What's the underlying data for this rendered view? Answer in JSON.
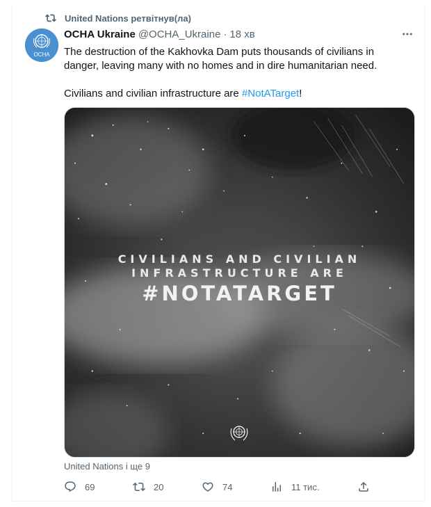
{
  "retweet": {
    "label": "United Nations ретвітнув(ла)",
    "icon": "retweet-icon"
  },
  "tweet": {
    "author_name": "OCHA Ukraine",
    "author_handle": "@OCHA_Ukraine",
    "separator": "·",
    "time": "18 хв",
    "avatar_text": "OCHA",
    "text_line1": "The destruction of the Kakhovka Dam puts thousands of civilians in danger, leaving many with no homes and in dire humanitarian need.",
    "text_line2_before": "Civilians and civilian infrastructure are ",
    "hashtag": "#NotATarget",
    "text_line2_after": "!"
  },
  "media": {
    "line1": "CIVILIANS AND CIVILIAN",
    "line2": "INFRASTRUCTURE ARE",
    "line3": "#NOTATARGET"
  },
  "liked_by": "United Nations і ще 9",
  "actions": {
    "reply_count": "69",
    "retweet_count": "20",
    "like_count": "74",
    "views_count": "11 тис."
  },
  "colors": {
    "accent": "#1d9bf0",
    "muted": "#536471",
    "text": "#0f1419",
    "avatar_bg": "#4a90d0"
  }
}
